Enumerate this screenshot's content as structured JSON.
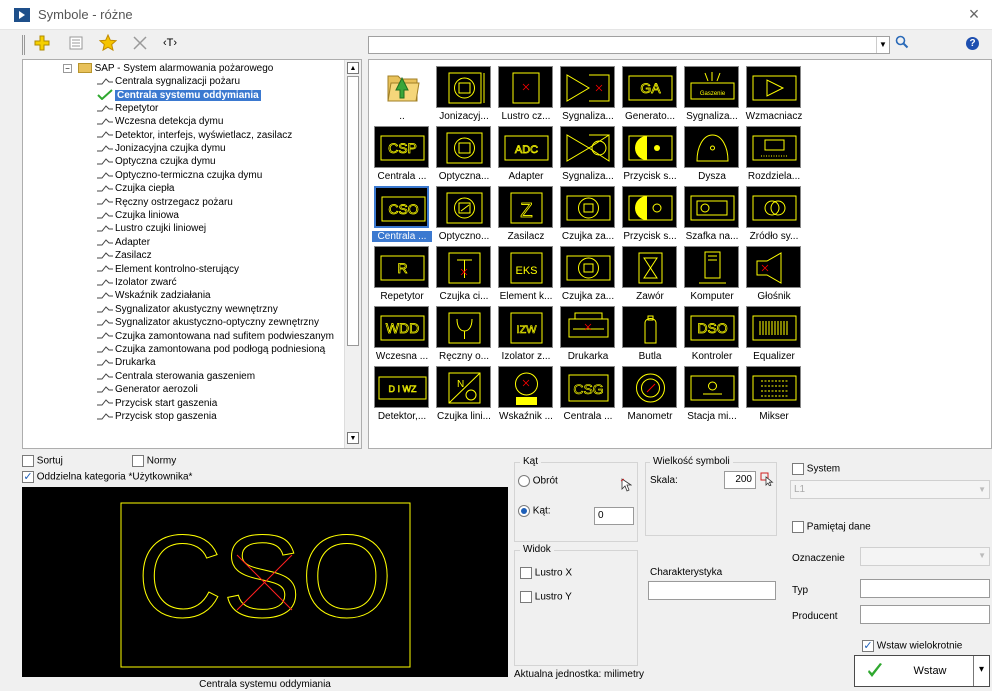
{
  "window": {
    "title": "Symbole - różne",
    "close_glyph": "×"
  },
  "toolbar": {
    "icons": [
      "add-icon",
      "list-icon",
      "star-icon",
      "delete-icon",
      "text-icon"
    ],
    "text_glyph": "‹T›",
    "help_glyph": "?"
  },
  "tree": {
    "root_label": "SAP - System alarmowania pożarowego",
    "items": [
      "Centrala sygnalizacji pożaru",
      "Centrala systemu oddymiania",
      "Repetytor",
      "Wczesna detekcja dymu",
      "Detektor, interfejs, wyświetlacz, zasilacz",
      "Jonizacyjna czujka dymu",
      "Optyczna czujka dymu",
      "Optyczno-termiczna czujka dymu",
      "Czujka ciepła",
      "Ręczny ostrzegacz pożaru",
      "Czujka liniowa",
      "Lustro czujki liniowej",
      "Adapter",
      "Zasilacz",
      "Element kontrolno-sterujący",
      "Izolator zwarć",
      "Wskaźnik zadziałania",
      "Sygnalizator akustyczny wewnętrzny",
      "Sygnalizator akustyczno-optyczny zewnętrzny",
      "Czujka zamontowana nad sufitem podwieszanym",
      "Czujka zamontowana pod podłogą podniesioną",
      "Drukarka",
      "Centrala sterowania gaszeniem",
      "Generator aerozoli",
      "Przycisk start gaszenia",
      "Przycisk stop gaszenia"
    ],
    "selected_index": 1
  },
  "symbols": [
    [
      "..",
      "Jonizacyj...",
      "Lustro cz...",
      "Sygnaliza...",
      "Generato...",
      "Sygnaliza...",
      "Wzmacniacz"
    ],
    [
      "Centrala ...",
      "Optyczna...",
      "Adapter",
      "Sygnaliza...",
      "Przycisk s...",
      "Dysza",
      "Rozdziela..."
    ],
    [
      "Centrala ...",
      "Optyczno...",
      "Zasilacz",
      "Czujka za...",
      "Przycisk s...",
      "Szafka na...",
      "Źródło sy..."
    ],
    [
      "Repetytor",
      "Czujka ci...",
      "Element k...",
      "Czujka za...",
      "Zawór",
      "Komputer",
      "Głośnik"
    ],
    [
      "Wczesna ...",
      "Ręczny o...",
      "Izolator z...",
      "Drukarka",
      "Butla",
      "Kontroler",
      "Equalizer"
    ],
    [
      "Detektor,...",
      "Czujka lini...",
      "Wskaźnik ...",
      "Centrala ...",
      "Manometr",
      "Stacja mi...",
      "Mikser"
    ]
  ],
  "symbol_texts": {
    "csp": "CSP",
    "cso": "CSO",
    "adc": "ADC",
    "ga": "GA",
    "eks": "EKS",
    "izw": "IZW",
    "wdd": "WDD",
    "dso": "DSO",
    "csg": "CSG",
    "r": "R",
    "z": "Z",
    "diwz": "D I WZ",
    "gaszenie": "Gaszenie"
  },
  "options": {
    "sortuj": {
      "label": "Sortuj",
      "checked": false
    },
    "normy": {
      "label": "Normy",
      "checked": false
    },
    "oddzielna": {
      "label": "Oddzielna kategoria *Użytkownika*",
      "checked": true
    }
  },
  "preview": {
    "text": "CSO",
    "caption": "Centrala systemu oddymiania"
  },
  "kat": {
    "legend": "Kąt",
    "obrot_label": "Obrót",
    "kat_label": "Kąt:",
    "kat_value": "0",
    "selected": "kat"
  },
  "wielkosc": {
    "legend": "Wielkość symboli",
    "skala_label": "Skala:",
    "skala_value": "200"
  },
  "widok": {
    "legend": "Widok",
    "lustro_x": "Lustro X",
    "lustro_y": "Lustro Y"
  },
  "charakterystyka": {
    "label": "Charakterystyka",
    "value": ""
  },
  "system": {
    "label": "System",
    "checked": false,
    "value": "L1"
  },
  "pamietaj": {
    "label": "Pamiętaj dane",
    "checked": false
  },
  "oznaczenie": {
    "label": "Oznaczenie",
    "value": ""
  },
  "typ": {
    "label": "Typ",
    "value": ""
  },
  "producent": {
    "label": "Producent",
    "value": ""
  },
  "wstaw_wielokrotnie": {
    "label": "Wstaw wielokrotnie",
    "checked": true
  },
  "wstaw": {
    "label": "Wstaw",
    "dropdown_glyph": "▾"
  },
  "status": {
    "units": "Aktualna jednostka: milimetry"
  },
  "colors": {
    "accent": "#3b79d0",
    "symbol": "#ffff00",
    "symbol_cross": "#ff0000"
  }
}
